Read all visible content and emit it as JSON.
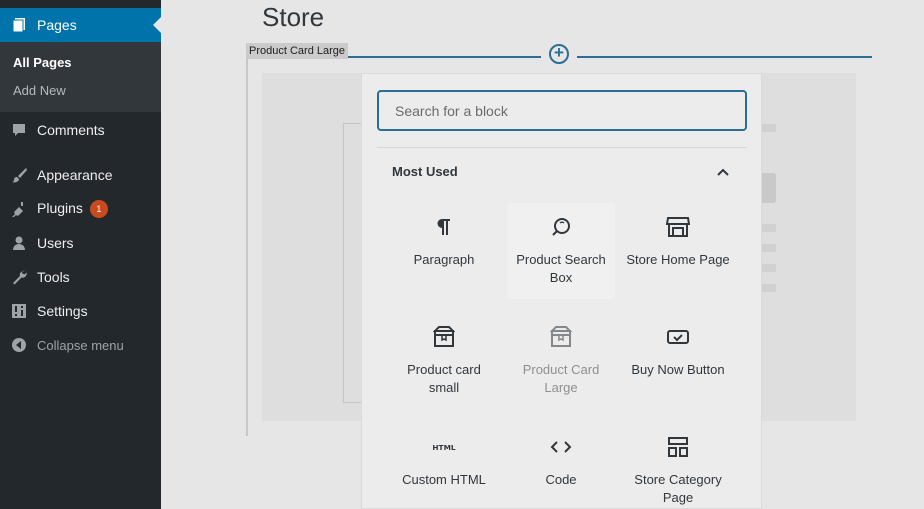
{
  "sidebar": {
    "pages_label": "Pages",
    "submenu": {
      "all_pages": "All Pages",
      "add_new": "Add New"
    },
    "items": [
      {
        "label": "Comments"
      },
      {
        "label": "Appearance"
      },
      {
        "label": "Plugins",
        "badge": "1"
      },
      {
        "label": "Users"
      },
      {
        "label": "Tools"
      },
      {
        "label": "Settings"
      },
      {
        "label": "Collapse menu"
      }
    ]
  },
  "editor": {
    "page_title": "Store",
    "block_label": "Product Card Large"
  },
  "inserter": {
    "search_placeholder": "Search for a block",
    "panel_title": "Most Used",
    "blocks": [
      {
        "label": "Paragraph",
        "icon": "paragraph-icon"
      },
      {
        "label": "Product Search Box",
        "icon": "search-icon"
      },
      {
        "label": "Store Home Page",
        "icon": "store-icon"
      },
      {
        "label": "Product card small",
        "icon": "box-icon"
      },
      {
        "label": "Product Card Large",
        "icon": "box-icon"
      },
      {
        "label": "Buy Now Button",
        "icon": "button-icon"
      },
      {
        "label": "Custom HTML",
        "icon": "html-icon"
      },
      {
        "label": "Code",
        "icon": "code-icon"
      },
      {
        "label": "Store Category Page",
        "icon": "grid-icon"
      }
    ]
  },
  "colors": {
    "sidebar_bg": "#23282d",
    "accent": "#0073aa",
    "focus_blue": "#2b6e93",
    "badge": "#ca4a1f"
  }
}
